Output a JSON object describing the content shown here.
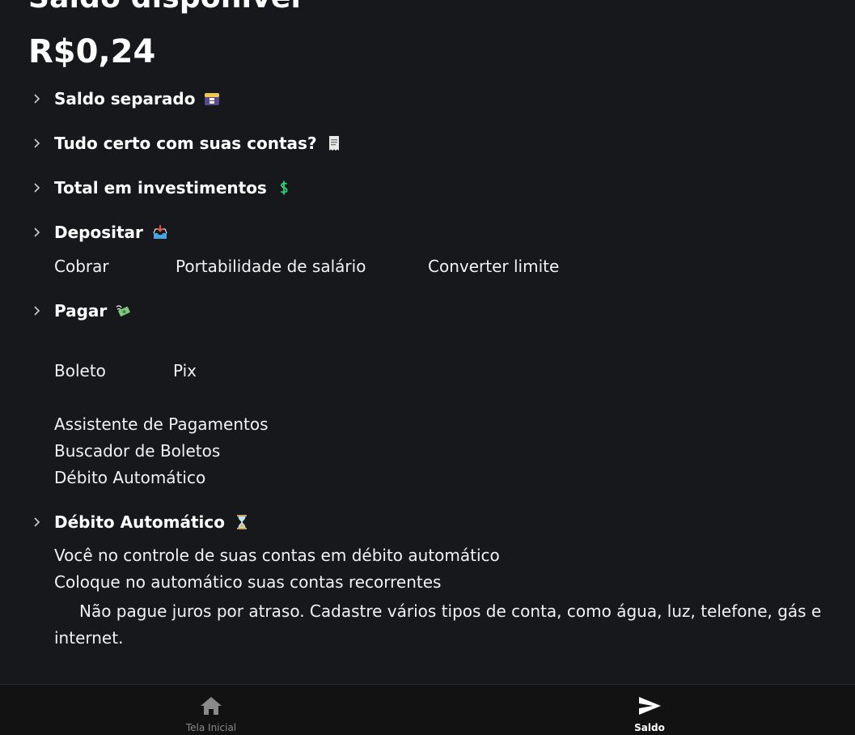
{
  "header": {
    "title": "Saldo disponível",
    "balance": "R$0,24"
  },
  "sections": {
    "saldo_separado": {
      "label": "Saldo separado",
      "icon": "card-index-icon"
    },
    "contas": {
      "label": "Tudo certo com suas contas?",
      "icon": "receipt-icon"
    },
    "investimentos": {
      "label": "Total em investimentos",
      "icon": "dollar-sign-icon"
    },
    "depositar": {
      "label": "Depositar",
      "icon": "inbox-tray-icon",
      "options": [
        "Cobrar",
        "Portabilidade de salário",
        "Converter limite"
      ]
    },
    "pagar": {
      "label": "Pagar",
      "icon": "money-with-wings-icon",
      "options": [
        "Boleto",
        "Pix"
      ],
      "links": [
        "Assistente de Pagamentos",
        "Buscador de Boletos",
        "Débito Automático"
      ]
    },
    "debito": {
      "label": "Débito Automático",
      "icon": "hourglass-icon",
      "lines": [
        "Você no controle de suas contas em débito automático",
        "Coloque no automático suas contas recorrentes"
      ],
      "paragraph": "Não pague juros por atraso. Cadastre vários tipos de conta, como água, luz, telefone, gás e internet."
    }
  },
  "nav": {
    "home": {
      "label": "Tela Inicial",
      "icon": "home-icon"
    },
    "saldo": {
      "label": "Saldo",
      "icon": "send-icon"
    }
  },
  "colors": {
    "background": "#17181b",
    "bottom_bar": "#121213",
    "text": "#ffffff",
    "inactive": "#8a8a8a",
    "dollar_green": "#2ecc71"
  }
}
